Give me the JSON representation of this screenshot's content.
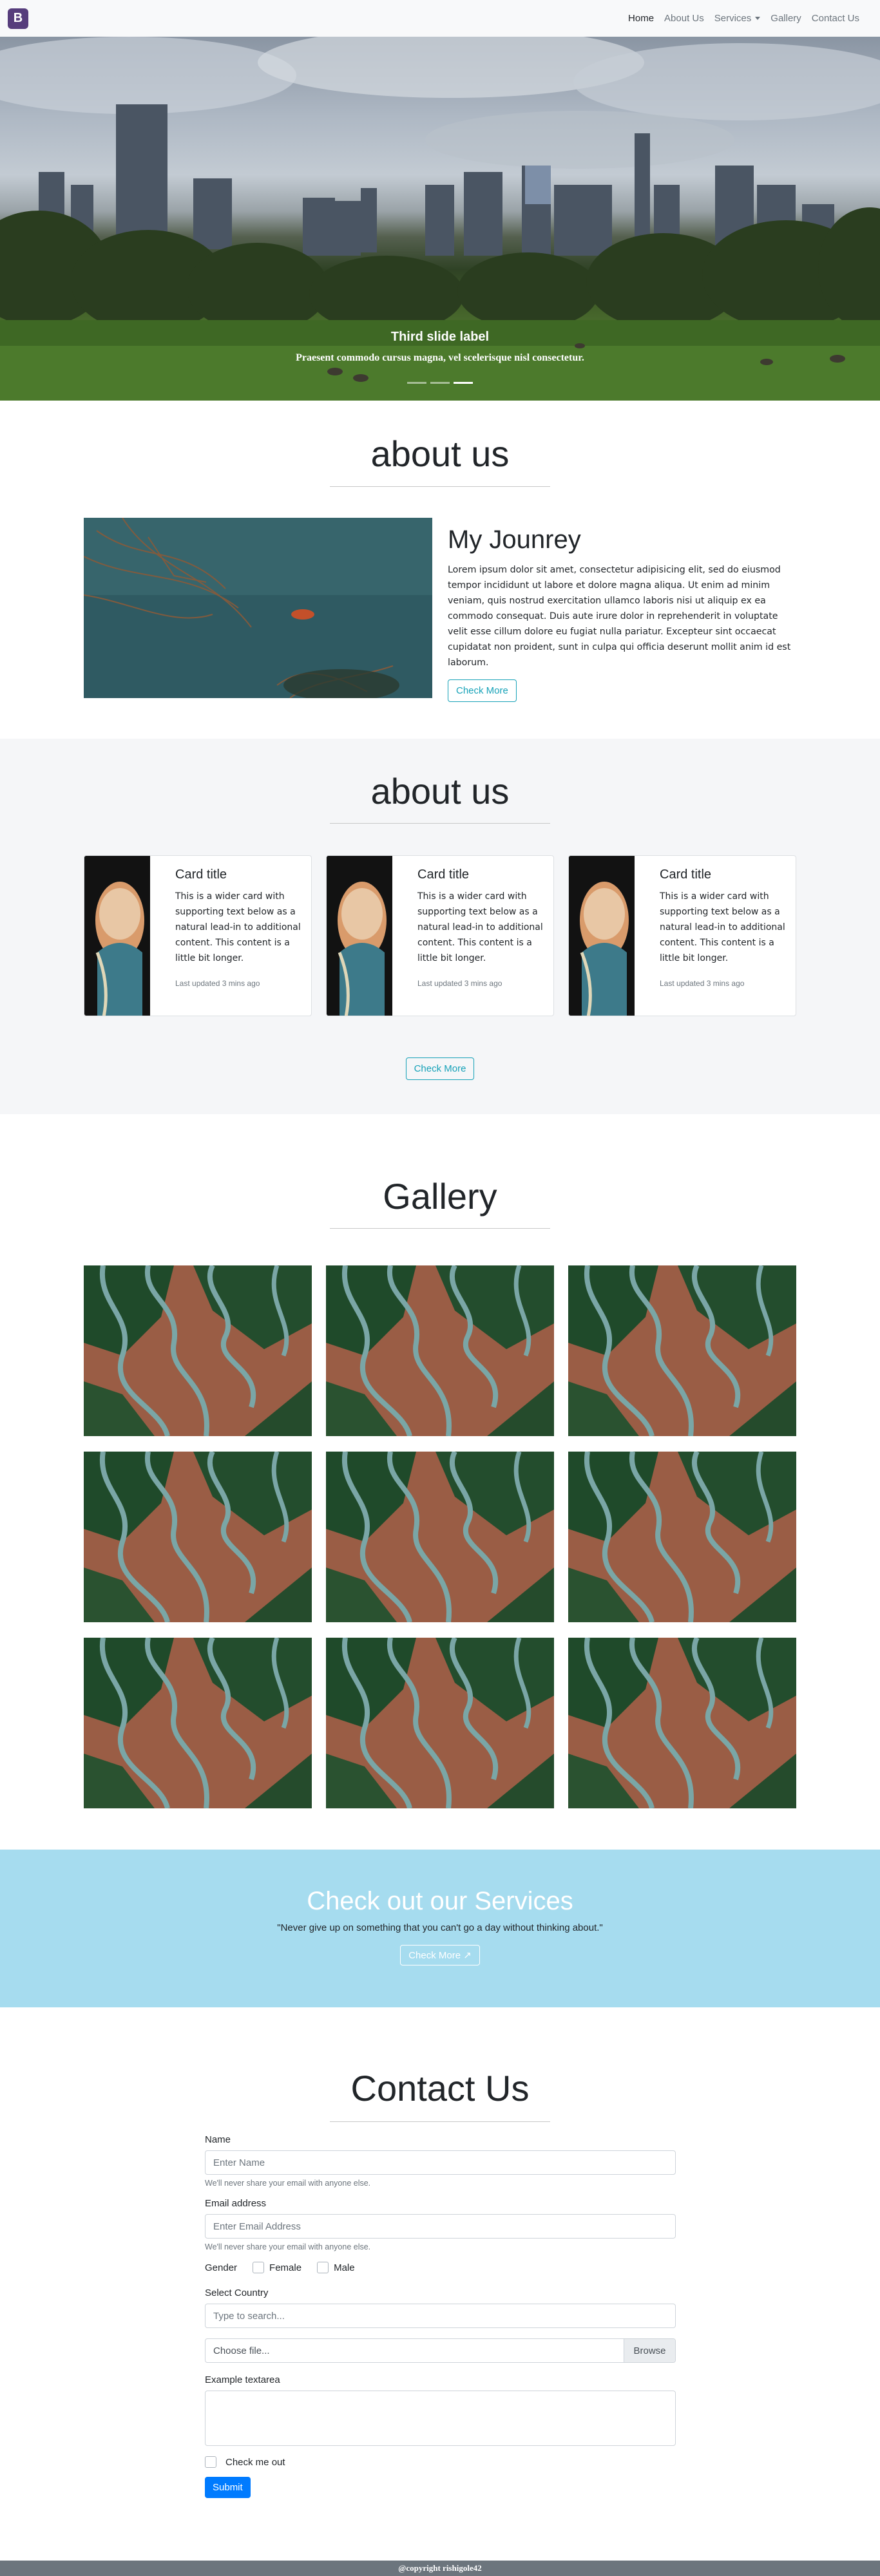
{
  "navbar": {
    "brand": "B",
    "links": [
      {
        "label": "Home"
      },
      {
        "label": "About Us"
      },
      {
        "label": "Services"
      },
      {
        "label": "Gallery"
      },
      {
        "label": "Contact Us"
      }
    ]
  },
  "hero": {
    "caption_title": "Third slide label",
    "caption_text": "Praesent commodo cursus magna, vel scelerisque nisl consectetur.",
    "slide_count": 3,
    "active_slide": 3
  },
  "about1": {
    "title": "about us",
    "heading": "My Jounrey",
    "body": "Lorem ipsum dolor sit amet, consectetur adipisicing elit, sed do eiusmod tempor incididunt ut labore et dolore magna aliqua. Ut enim ad minim veniam, quis nostrud exercitation ullamco laboris nisi ut aliquip ex ea commodo consequat. Duis aute irure dolor in reprehenderit in voluptate velit esse cillum dolore eu fugiat nulla pariatur. Excepteur sint occaecat cupidatat non proident, sunt in culpa qui officia deserunt mollit anim id est laborum.",
    "button": "Check More"
  },
  "about2": {
    "title": "about us",
    "cards": [
      {
        "title": "Card title",
        "text": "This is a wider card with supporting text below as a natural lead-in to additional content. This content is a little bit longer.",
        "updated": "Last updated 3 mins ago"
      },
      {
        "title": "Card title",
        "text": "This is a wider card with supporting text below as a natural lead-in to additional content. This content is a little bit longer.",
        "updated": "Last updated 3 mins ago"
      },
      {
        "title": "Card title",
        "text": "This is a wider card with supporting text below as a natural lead-in to additional content. This content is a little bit longer.",
        "updated": "Last updated 3 mins ago"
      }
    ],
    "button": "Check More"
  },
  "gallery": {
    "title": "Gallery",
    "image_count": 9
  },
  "services": {
    "title": "Check out our Services",
    "quote": "\"Never give up on something that you can't go a day without thinking about.\"",
    "button": "Check More",
    "colors": {
      "background": "#a6dcef"
    }
  },
  "contact": {
    "title": "Contact Us",
    "name_label": "Name",
    "name_placeholder": "Enter Name",
    "name_help": "We'll never share your email with anyone else.",
    "email_label": "Email address",
    "email_placeholder": "Enter Email Address",
    "email_help": "We'll never share your email with anyone else.",
    "gender_label": "Gender",
    "gender_options": [
      "Female",
      "Male"
    ],
    "country_label": "Select Country",
    "country_placeholder": "Type to search...",
    "file_text": "Choose file...",
    "file_button": "Browse",
    "textarea_label": "Example textarea",
    "checkbox_label": "Check me out",
    "submit": "Submit"
  },
  "footer": {
    "text": "@copyright rishigole42"
  }
}
